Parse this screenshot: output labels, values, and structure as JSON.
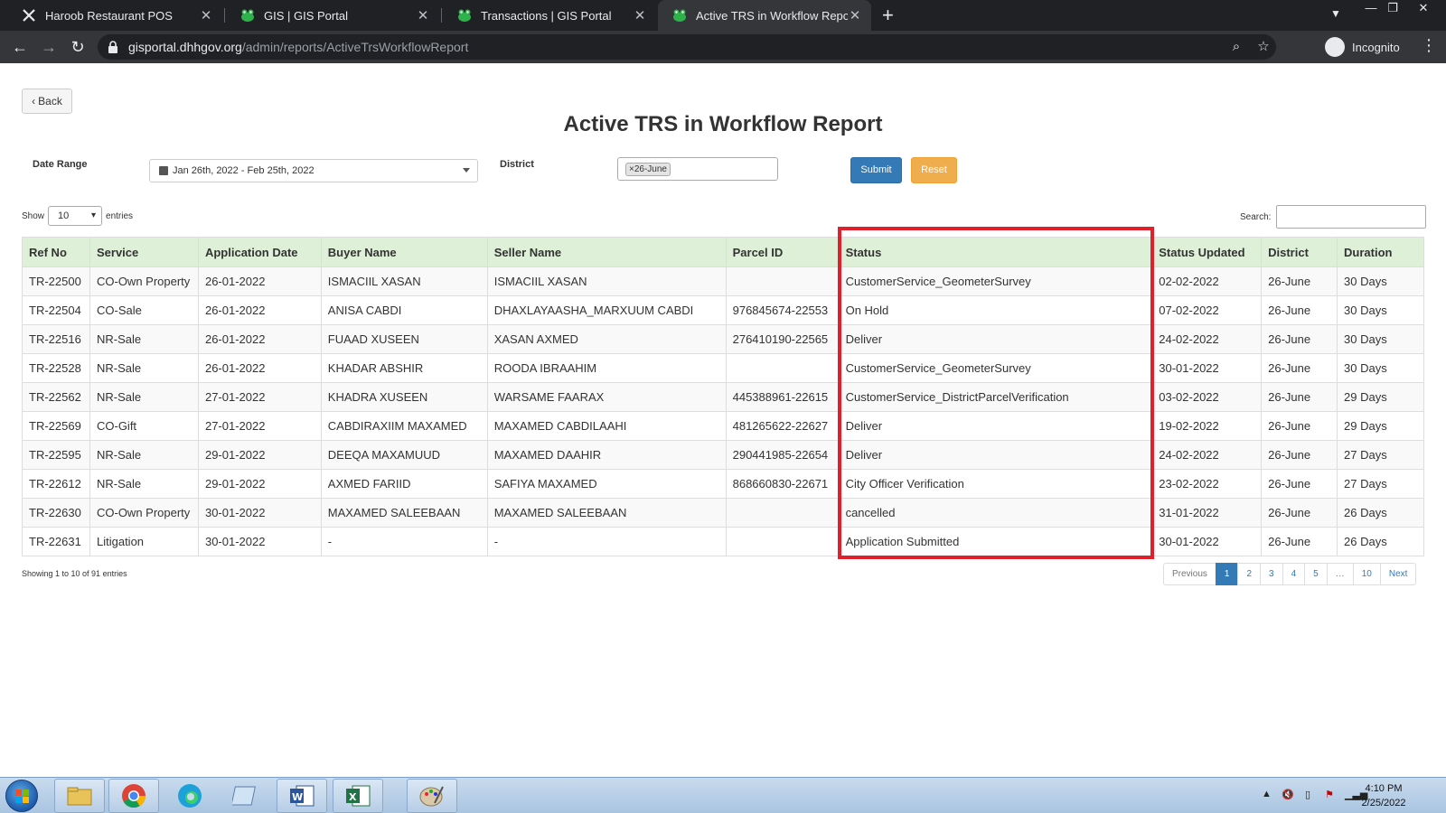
{
  "browser": {
    "tabs": [
      {
        "title": "Haroob Restaurant POS",
        "active": false,
        "icon": "x-logo-icon"
      },
      {
        "title": "GIS | GIS Portal",
        "active": false,
        "icon": "gis-frog-icon"
      },
      {
        "title": "Transactions | GIS Portal",
        "active": false,
        "icon": "gis-frog-icon"
      },
      {
        "title": "Active TRS in Workflow Report",
        "active": true,
        "icon": "gis-frog-icon"
      }
    ],
    "url_host": "gisportal.dhhgov.org",
    "url_path": "/admin/reports/ActiveTrsWorkflowReport",
    "profile_label": "Incognito"
  },
  "page": {
    "back_label": "Back",
    "title": "Active TRS in Workflow Report",
    "filters": {
      "date_range_label": "Date Range",
      "date_range_value": "Jan 26th, 2022 - Feb 25th, 2022",
      "district_label": "District",
      "district_chip": "26-June",
      "submit_label": "Submit",
      "reset_label": "Reset"
    },
    "length": {
      "show_label": "Show",
      "value": "10",
      "entries_label": "entries"
    },
    "search_label": "Search:",
    "table": {
      "columns": [
        "Ref No",
        "Service",
        "Application Date",
        "Buyer Name",
        "Seller Name",
        "Parcel ID",
        "Status",
        "Status Updated",
        "District",
        "Duration"
      ],
      "rows": [
        [
          "TR-22500",
          "CO-Own Property",
          "26-01-2022",
          "ISMACIIL XASAN",
          "ISMACIIL XASAN",
          "",
          "CustomerService_GeometerSurvey",
          "02-02-2022",
          "26-June",
          "30 Days"
        ],
        [
          "TR-22504",
          "CO-Sale",
          "26-01-2022",
          "ANISA CABDI",
          "DHAXLAYAASHA_MARXUUM CABDI",
          "976845674-22553",
          "On Hold",
          "07-02-2022",
          "26-June",
          "30 Days"
        ],
        [
          "TR-22516",
          "NR-Sale",
          "26-01-2022",
          "FUAAD XUSEEN",
          "XASAN AXMED",
          "276410190-22565",
          "Deliver",
          "24-02-2022",
          "26-June",
          "30 Days"
        ],
        [
          "TR-22528",
          "NR-Sale",
          "26-01-2022",
          "KHADAR ABSHIR",
          "ROODA IBRAAHIM",
          "",
          "CustomerService_GeometerSurvey",
          "30-01-2022",
          "26-June",
          "30 Days"
        ],
        [
          "TR-22562",
          "NR-Sale",
          "27-01-2022",
          "KHADRA XUSEEN",
          "WARSAME FAARAX",
          "445388961-22615",
          "CustomerService_DistrictParcelVerification",
          "03-02-2022",
          "26-June",
          "29 Days"
        ],
        [
          "TR-22569",
          "CO-Gift",
          "27-01-2022",
          "CABDIRAXIIM MAXAMED",
          "MAXAMED CABDILAAHI",
          "481265622-22627",
          "Deliver",
          "19-02-2022",
          "26-June",
          "29 Days"
        ],
        [
          "TR-22595",
          "NR-Sale",
          "29-01-2022",
          "DEEQA MAXAMUUD",
          "MAXAMED DAAHIR",
          "290441985-22654",
          "Deliver",
          "24-02-2022",
          "26-June",
          "27 Days"
        ],
        [
          "TR-22612",
          "NR-Sale",
          "29-01-2022",
          "AXMED FARIID",
          "SAFIYA MAXAMED",
          "868660830-22671",
          "City Officer Verification",
          "23-02-2022",
          "26-June",
          "27 Days"
        ],
        [
          "TR-22630",
          "CO-Own Property",
          "30-01-2022",
          "MAXAMED SALEEBAAN",
          "MAXAMED SALEEBAAN",
          "",
          "cancelled",
          "31-01-2022",
          "26-June",
          "26 Days"
        ],
        [
          "TR-22631",
          "Litigation",
          "30-01-2022",
          "-",
          "-",
          "",
          "Application Submitted",
          "30-01-2022",
          "26-June",
          "26 Days"
        ]
      ]
    },
    "info_text": "Showing 1 to 10 of 91 entries",
    "pagination": [
      "Previous",
      "1",
      "2",
      "3",
      "4",
      "5",
      "…",
      "10",
      "Next"
    ],
    "pagination_active": "1"
  },
  "taskbar": {
    "apps": [
      "file-explorer-icon",
      "chrome-icon",
      "edge-icon",
      "notepad-icon",
      "word-icon",
      "excel-icon",
      "paint-icon"
    ],
    "time": "4:10 PM",
    "date": "2/25/2022"
  },
  "colors": {
    "highlight": "#e0202a",
    "header_bg": "#dff0d8",
    "primary": "#337ab7",
    "warning": "#f0ad4e"
  }
}
